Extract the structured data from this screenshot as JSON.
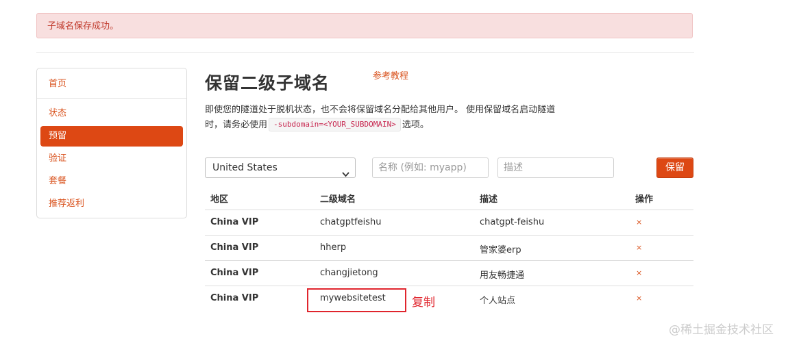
{
  "alert": {
    "message": "子域名保存成功。"
  },
  "sidebar": {
    "items": [
      {
        "label": "首页"
      },
      {
        "label": "状态"
      },
      {
        "label": "预留"
      },
      {
        "label": "验证"
      },
      {
        "label": "套餐"
      },
      {
        "label": "推荐返利"
      }
    ],
    "active_index": 2
  },
  "page": {
    "title": "保留二级子域名",
    "tutorial_link": "参考教程",
    "description_line1": "即使您的隧道处于脱机状态，也不会将保留域名分配给其他用户。 使用保留域名启动隧道",
    "description_line2_prefix": "时，请务必使用",
    "description_code": "-subdomain=<YOUR_SUBDOMAIN>",
    "description_line2_suffix": "选项。"
  },
  "form": {
    "region_selected": "United States",
    "name_placeholder": "名称 (例如: myapp)",
    "desc_placeholder": "描述",
    "submit_label": "保留"
  },
  "table": {
    "headers": [
      "地区",
      "二级域名",
      "描述",
      "操作"
    ],
    "rows": [
      {
        "region": "China VIP",
        "subdomain": "chatgptfeishu",
        "description": "chatgpt-feishu",
        "action": "×"
      },
      {
        "region": "China VIP",
        "subdomain": "hherp",
        "description": "管家婆erp",
        "action": "×"
      },
      {
        "region": "China VIP",
        "subdomain": "changjietong",
        "description": "用友畅捷通",
        "action": "×"
      },
      {
        "region": "China VIP",
        "subdomain": "mywebsitetest",
        "description": "个人站点",
        "action": "×"
      }
    ]
  },
  "annotation": {
    "label": "复制"
  },
  "watermark": "@稀土掘金技术社区",
  "colors": {
    "accent": "#dd4814",
    "alert_bg": "#f8dfdf",
    "annotation": "#e0252d"
  }
}
